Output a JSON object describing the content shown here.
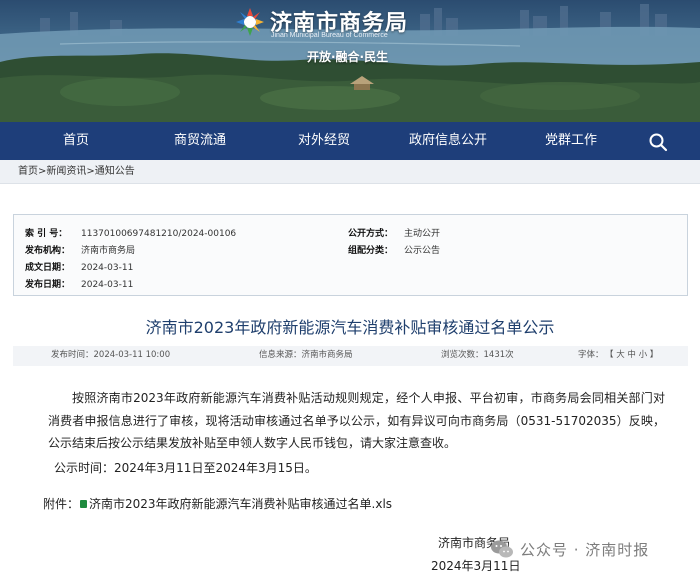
{
  "header": {
    "logo_title": "济南市商务局",
    "logo_subtitle": "Jinan Municipal Bureau of Commerce",
    "slogan": "开放·融合·民生"
  },
  "nav": {
    "items": [
      "首页",
      "商贸流通",
      "对外经贸",
      "政府信息公开",
      "党群工作"
    ]
  },
  "breadcrumb": {
    "home": "首页",
    "sep1": ">",
    "news": "新闻资讯",
    "sep2": ">",
    "notice": "通知公告"
  },
  "meta": {
    "index_label": "索 引 号：",
    "index_value": "11370100697481210/2024-00106",
    "publish_mode_label": "公开方式：",
    "publish_mode_value": "主动公开",
    "issuer_label": "发布机构：",
    "issuer_value": "济南市商务局",
    "category_label": "组配分类：",
    "category_value": "公示公告",
    "created_label": "成文日期：",
    "created_value": "2024-03-11",
    "published_label": "发布日期：",
    "published_value": "2024-03-11"
  },
  "article": {
    "title": "济南市2023年政府新能源汽车消费补贴审核通过名单公示",
    "publish_time": "发布时间：2024-03-11 10:00",
    "source": "信息来源：济南市商务局",
    "views": "浏览次数：1431次",
    "font_label": "字体：",
    "font_sizes": "【 大 中 小 】",
    "body": "按照济南市2023年政府新能源汽车消费补贴活动规则规定，经个人申报、平台初审，市商务局会同相关部门对消费者申报信息进行了审核，现将活动审核通过名单予以公示，如有异议可向市商务局（0531-51702035）反映，公示结束后按公示结果发放补贴至申领人数字人民币钱包，请大家注意查收。",
    "notice_period": "公示时间：2024年3月11日至2024年3月15日。",
    "attachment_label": "附件：",
    "attachment_name": "济南市2023年政府新能源汽车消费补贴审核通过名单.xls",
    "signature_org": "济南市商务局",
    "signature_date": "2024年3月11日"
  },
  "watermark": {
    "text": "公众号 · 济南时报"
  },
  "colors": {
    "nav_bg": "#1e3e7a",
    "title": "#1f3f6d",
    "attachment_icon": "#1e8a3e"
  },
  "icons": {
    "search": "search-icon",
    "logo": "logo-mark-icon",
    "attachment": "excel-file-icon",
    "watermark": "wechat-icon"
  }
}
